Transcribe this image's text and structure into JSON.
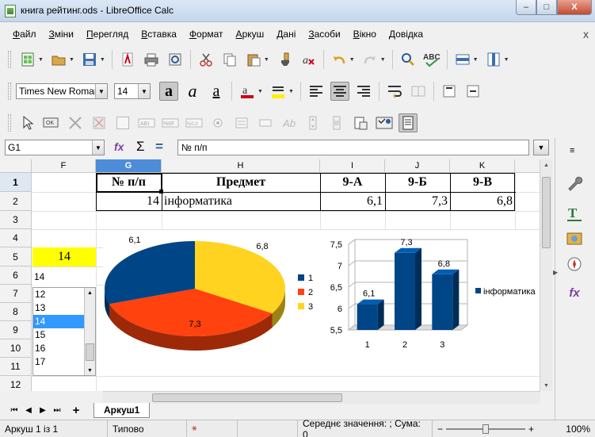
{
  "window": {
    "title": "книга рейтинг.ods - LibreOffice Calc",
    "minimize_label": "‒",
    "maximize_label": "□",
    "close_label": "X"
  },
  "menu": {
    "items": [
      "Файл",
      "Зміни",
      "Перегляд",
      "Вставка",
      "Формат",
      "Аркуш",
      "Дані",
      "Засоби",
      "Вікно",
      "Довідка"
    ],
    "close_glyph": "x"
  },
  "toolbar": {
    "font_name": "Times New Roman",
    "font_size": "14",
    "zoom_control_label": "%0.0",
    "percent_label": "%6F"
  },
  "formula_bar": {
    "name_box": "G1",
    "content": "№ п/п",
    "function_wizard_label": "fx",
    "sum_label": "Σ",
    "equals_label": "="
  },
  "grid": {
    "columns": [
      "F",
      "G",
      "H",
      "I",
      "J",
      "K"
    ],
    "active_column": "G",
    "rows": [
      "1",
      "2",
      "3",
      "4",
      "5",
      "6",
      "7",
      "8",
      "9",
      "10",
      "11",
      "12"
    ],
    "active_row": "1",
    "header_row": [
      "№ п/п",
      "Предмет",
      "9-А",
      "9-Б",
      "9-В"
    ],
    "data_row": [
      "14",
      "інформатика",
      "6,1",
      "7,3",
      "6,8"
    ],
    "yellow_cell_value": "14",
    "input_cell_value": "14"
  },
  "listbox": {
    "items": [
      "12",
      "13",
      "14",
      "15",
      "16",
      "17"
    ],
    "selected": "14"
  },
  "chart_data": [
    {
      "type": "pie",
      "categories": [
        "1",
        "2",
        "3"
      ],
      "values": [
        6.1,
        7.3,
        6.8
      ],
      "data_labels": [
        "6,1",
        "7,3",
        "6,8"
      ],
      "colors": [
        "#004586",
        "#ff420e",
        "#ffd320"
      ],
      "legend": [
        "1",
        "2",
        "3"
      ],
      "legend_position": "right",
      "title": ""
    },
    {
      "type": "bar",
      "categories": [
        "1",
        "2",
        "3"
      ],
      "series": [
        {
          "name": "інформатика",
          "values": [
            6.1,
            7.3,
            6.8
          ]
        }
      ],
      "data_labels": [
        "6,1",
        "7,3",
        "6,8"
      ],
      "ylim": [
        5.5,
        7.5
      ],
      "yticks": [
        "7,5",
        "7",
        "6,5",
        "6",
        "5,5"
      ],
      "color": "#004586",
      "legend_position": "right",
      "title": ""
    }
  ],
  "sheet_tabs": {
    "add_label": "+",
    "tabs": [
      "Аркуш1"
    ]
  },
  "status": {
    "sheet": "Аркуш 1 із 1",
    "style": "Типово",
    "summary": "Середнє значення: ; Сума: 0",
    "zoom_minus": "−",
    "zoom_plus": "+",
    "zoom": "100%"
  }
}
